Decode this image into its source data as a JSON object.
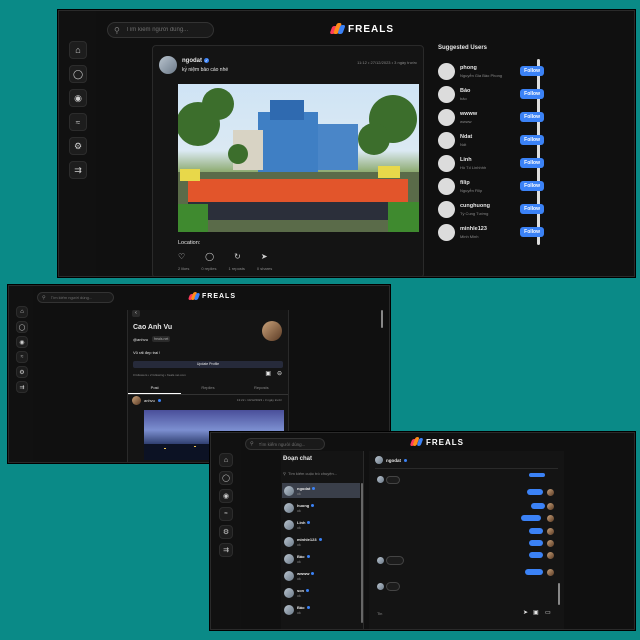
{
  "brand": "FREALS",
  "colors": {
    "background": "#0a8a87",
    "accent": "#3b82f6",
    "panel": "#101010"
  },
  "search_placeholder": "Tìm kiếm người dùng...",
  "sidebar_icons": [
    "home-icon",
    "user-icon",
    "messenger-icon",
    "activity-icon",
    "settings-icon",
    "logout-icon"
  ],
  "feed": {
    "post": {
      "username": "ngodat",
      "meta": "11:12 • 27/12/2023 • 3 ngày trước",
      "caption": "kỷ niệm bảo cáo nhé",
      "location_label": "Location:",
      "stats": [
        "2 likes",
        "0 replies",
        "1 reposts",
        "0 shares"
      ]
    },
    "suggested_title": "Suggested Users",
    "suggested_users": [
      {
        "name": "phong",
        "sub": "Nguyễn Gia Bảo Phong",
        "follow": "Follow"
      },
      {
        "name": "Bảo",
        "sub": "bảo",
        "follow": "Follow"
      },
      {
        "name": "wwww",
        "sub": "wwww",
        "follow": "Follow"
      },
      {
        "name": "Ndat",
        "sub": "Ndt",
        "follow": "Follow"
      },
      {
        "name": "Linh",
        "sub": "Hồ Tố Linhhhh",
        "follow": "Follow"
      },
      {
        "name": "filip",
        "sub": "Nguyễn Filip",
        "follow": "Follow"
      },
      {
        "name": "cunghuong",
        "sub": "Tỷ Cung Tường",
        "follow": "Follow"
      },
      {
        "name": "minhle123",
        "sub": "Minh Minh",
        "follow": "Follow"
      }
    ]
  },
  "profile": {
    "name": "Cao Anh Vu",
    "handle": "@anhvu",
    "handle_badge": "freals.net",
    "bio": "Vũ rất đẹp trai !",
    "update_button": "Update Profile",
    "stats": "0 followers • 2 following • freals.net.com",
    "tabs": [
      "Post",
      "Replies",
      "Reposts"
    ],
    "post": {
      "username": "anhvu",
      "meta": "13:22 • 10/12/2023 • 3 ngày trước"
    }
  },
  "chat": {
    "title": "Đoạn chat",
    "search_placeholder": "Tìm kiếm cuộc trò chuyện...",
    "conversations": [
      {
        "name": "ngodat",
        "preview": "ok"
      },
      {
        "name": "huong",
        "preview": "ok"
      },
      {
        "name": "Linh",
        "preview": "ok"
      },
      {
        "name": "minhle123",
        "preview": "ok"
      },
      {
        "name": "Bảo",
        "preview": "ok"
      },
      {
        "name": "wwww",
        "preview": "ok"
      },
      {
        "name": "son",
        "preview": "ok"
      },
      {
        "name": "Bảo",
        "preview": "ok"
      }
    ],
    "active_user": "ngodat",
    "message_placeholder": "Tin"
  }
}
